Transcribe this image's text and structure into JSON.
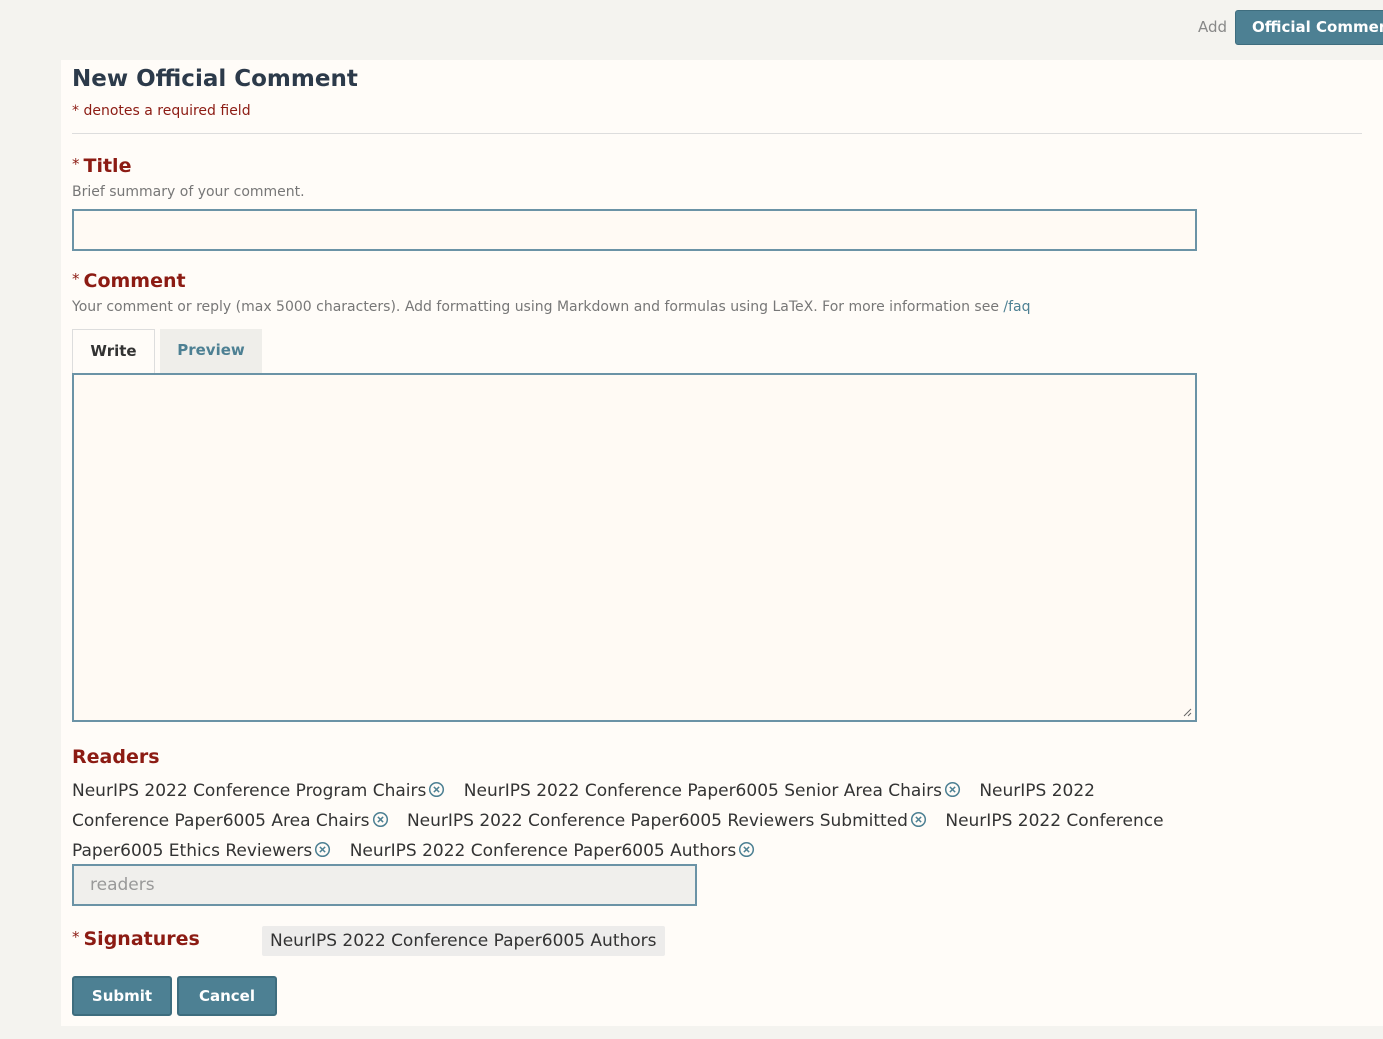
{
  "header": {
    "add_label": "Add",
    "official_comment_button": "Official Comment"
  },
  "form": {
    "title": "New Official Comment",
    "required_note": "* denotes a required field",
    "required_star": "*",
    "title_field": {
      "label": "Title",
      "description": "Brief summary of your comment.",
      "value": ""
    },
    "comment_field": {
      "label": "Comment",
      "description": "Your comment or reply (max 5000 characters). Add formatting using Markdown and formulas using LaTeX. For more information see",
      "faq_link": "/faq",
      "tabs": [
        {
          "label": "Write",
          "active": true
        },
        {
          "label": "Preview",
          "active": false
        }
      ],
      "value": ""
    },
    "readers": {
      "label": "Readers",
      "items": [
        "NeurIPS 2022 Conference Program Chairs",
        "NeurIPS 2022 Conference Paper6005 Senior Area Chairs",
        "NeurIPS 2022 Conference Paper6005 Area Chairs",
        "NeurIPS 2022 Conference Paper6005 Reviewers Submitted",
        "NeurIPS 2022 Conference Paper6005 Ethics Reviewers",
        "NeurIPS 2022 Conference Paper6005 Authors"
      ],
      "input_placeholder": "readers"
    },
    "signatures": {
      "label": "Signatures",
      "value": "NeurIPS 2022 Conference Paper6005 Authors"
    },
    "buttons": {
      "submit": "Submit",
      "cancel": "Cancel"
    }
  },
  "colors": {
    "accent": "#4d8093",
    "required": "#8c1b13",
    "page_bg": "#f4f3ef",
    "panel_bg": "#fffcf8"
  }
}
